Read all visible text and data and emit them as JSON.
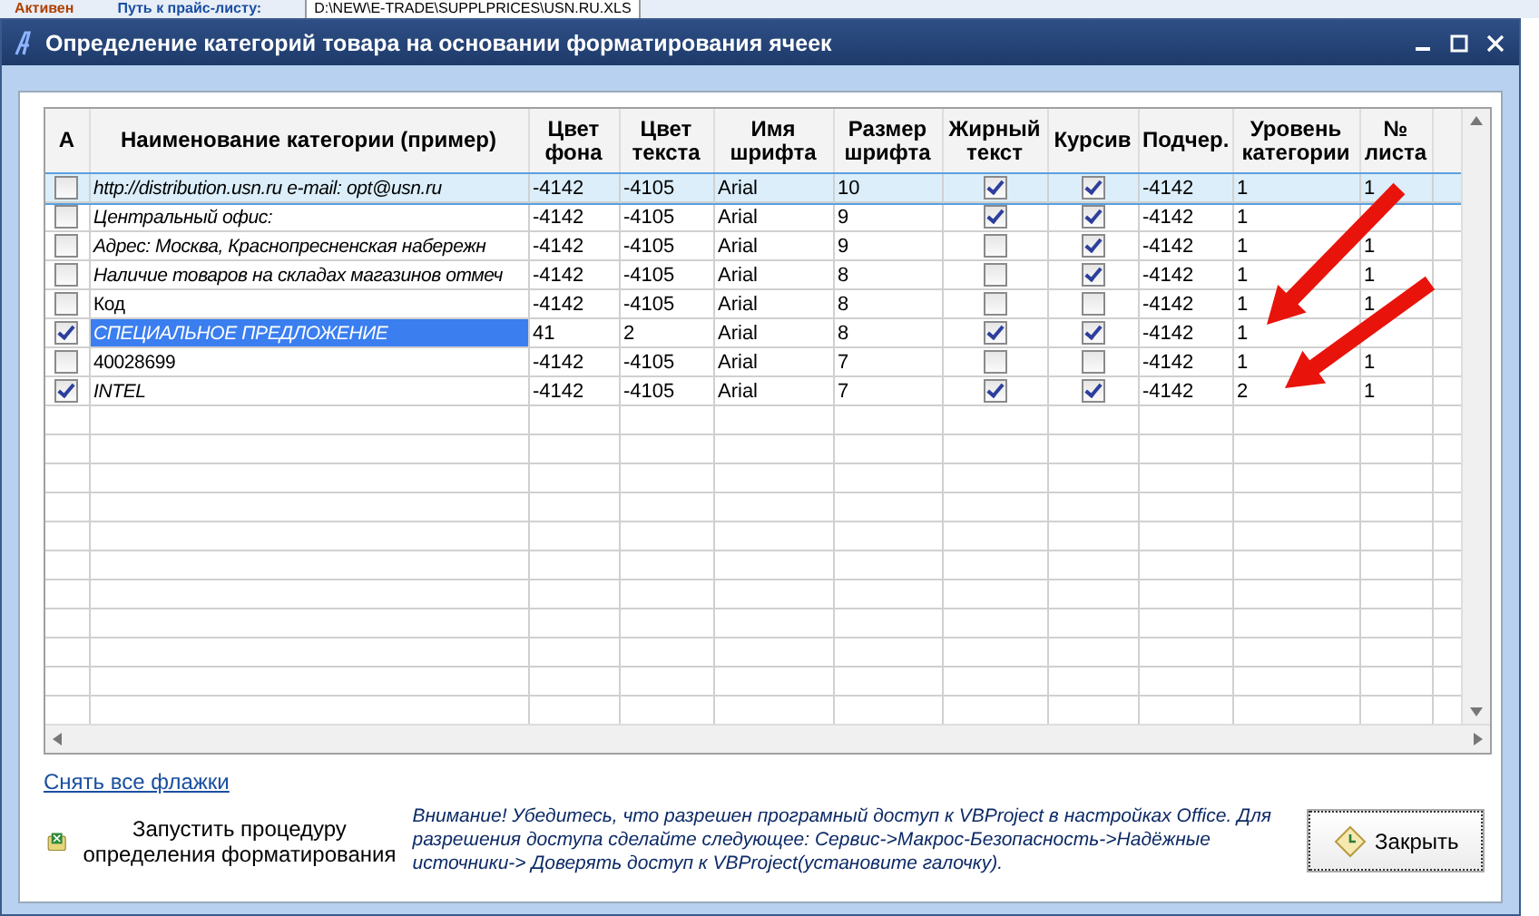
{
  "background_sheet": {
    "label_active": "Активен",
    "label_path": "Путь к прайс-листу:",
    "path_value": "D:\\NEW\\E-TRADE\\SUPPLPRICES\\USN.RU.XLS"
  },
  "window": {
    "title": "Определение категорий товара на основании форматирования ячеек"
  },
  "table": {
    "columns": [
      "A",
      "Наименование категории (пример)",
      "Цвет фона",
      "Цвет текста",
      "Имя шрифта",
      "Размер шрифта",
      "Жирный текст",
      "Курсив",
      "Подчер.",
      "Уровень категории",
      "№ листа"
    ],
    "rows": [
      {
        "checked": false,
        "name": "http://distribution.usn.ru     e-mail: opt@usn.ru",
        "bg": "-4142",
        "fg": "-4105",
        "font": "Arial",
        "size": "10",
        "bold": true,
        "italic": true,
        "underline": "-4142",
        "level_text": "1",
        "sheet": "1",
        "selected": true,
        "highlighted": false
      },
      {
        "checked": false,
        "name": "Центральный офис:",
        "bg": "-4142",
        "fg": "-4105",
        "font": "Arial",
        "size": "9",
        "bold": true,
        "italic": true,
        "underline": "-4142",
        "level_text": "1",
        "selected": false,
        "highlighted": false
      },
      {
        "checked": false,
        "name": "Адрес: Москва, Краснопресненская набережн",
        "bg": "-4142",
        "fg": "-4105",
        "font": "Arial",
        "size": "9",
        "bold": false,
        "italic": true,
        "underline": "-4142",
        "level_text": "1",
        "sheet": "1",
        "selected": false,
        "highlighted": false
      },
      {
        "checked": false,
        "name": "Наличие товаров на складах магазинов отмеч",
        "bg": "-4142",
        "fg": "-4105",
        "font": "Arial",
        "size": "8",
        "bold": false,
        "italic": true,
        "underline": "-4142",
        "level_text": "1",
        "sheet": "1",
        "selected": false,
        "highlighted": false
      },
      {
        "checked": false,
        "name": "Код",
        "bg": "-4142",
        "fg": "-4105",
        "font": "Arial",
        "size": "8",
        "bold": false,
        "italic": false,
        "underline": "-4142",
        "level_text": "1",
        "sheet": "1",
        "selected": false,
        "highlighted": false
      },
      {
        "checked": true,
        "name": "СПЕЦИАЛЬНОЕ ПРЕДЛОЖЕНИЕ",
        "bg": "41",
        "fg": "2",
        "font": "Arial",
        "size": "8",
        "bold": true,
        "italic": true,
        "underline": "-4142",
        "level_text": "1",
        "selected": false,
        "highlighted": true
      },
      {
        "checked": false,
        "name": "40028699",
        "bg": "-4142",
        "fg": "-4105",
        "font": "Arial",
        "size": "7",
        "bold": false,
        "italic": false,
        "underline": "-4142",
        "level_text": "1",
        "sheet": "1",
        "selected": false,
        "highlighted": false
      },
      {
        "checked": true,
        "name": "INTEL",
        "bg": "-4142",
        "fg": "-4105",
        "font": "Arial",
        "size": "7",
        "bold": true,
        "italic": true,
        "underline": "-4142",
        "level_text": "2",
        "sheet": "1",
        "selected": false,
        "highlighted": false
      }
    ]
  },
  "clear_link": "Снять все флажки",
  "run_button": "Запустить процедуру определения форматирования",
  "warning": "Внимание! Убедитесь, что разрешен програмный доступ к VBProject в настройках Office. Для разрешения доступа сделайте следующее: Сервис->Макрос-Безопасность->Надёжные источники-> Доверять доступ к VBProject(установите галочку).",
  "close_button": "Закрыть"
}
